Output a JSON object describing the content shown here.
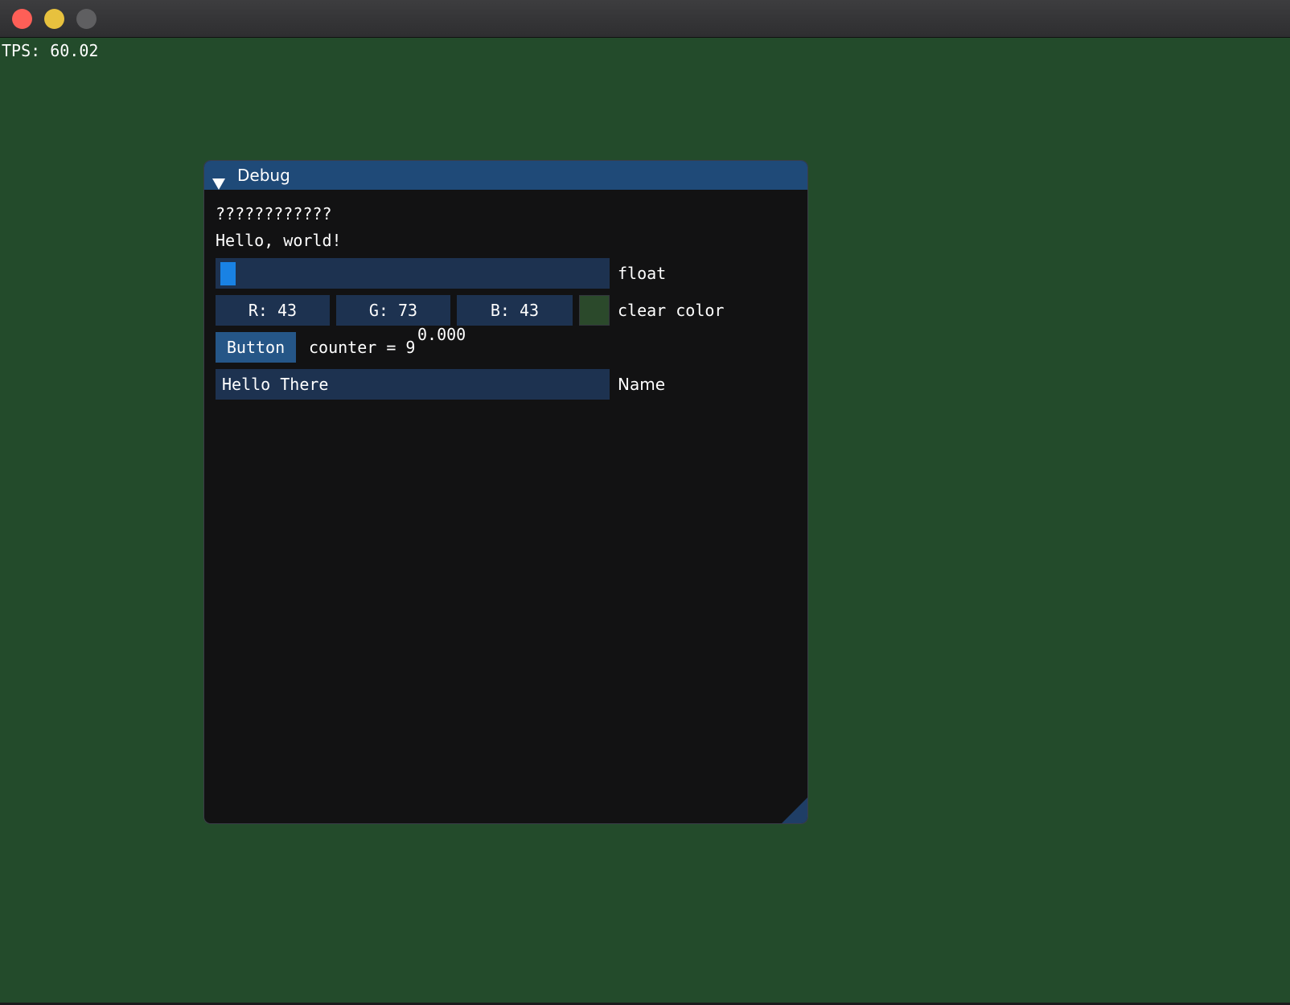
{
  "hud": {
    "tps": "TPS: 60.02"
  },
  "debug_window": {
    "title": "Debug",
    "line1": "????????????",
    "line2": "Hello, world!",
    "slider": {
      "value_text": "0.000",
      "label": "float",
      "value": 0.0
    },
    "color": {
      "r": "R: 43",
      "g": "G: 73",
      "b": "B: 43",
      "label": "clear color",
      "swatch": "#2b492b"
    },
    "button": {
      "label": "Button",
      "counter": "counter = 9"
    },
    "name_input": {
      "value": "Hello There",
      "label": "Name"
    }
  },
  "colors": {
    "clear": "#234b2b",
    "titlebar": "#1f4a78",
    "frame": "#1d3250",
    "accent": "#1982e4"
  }
}
